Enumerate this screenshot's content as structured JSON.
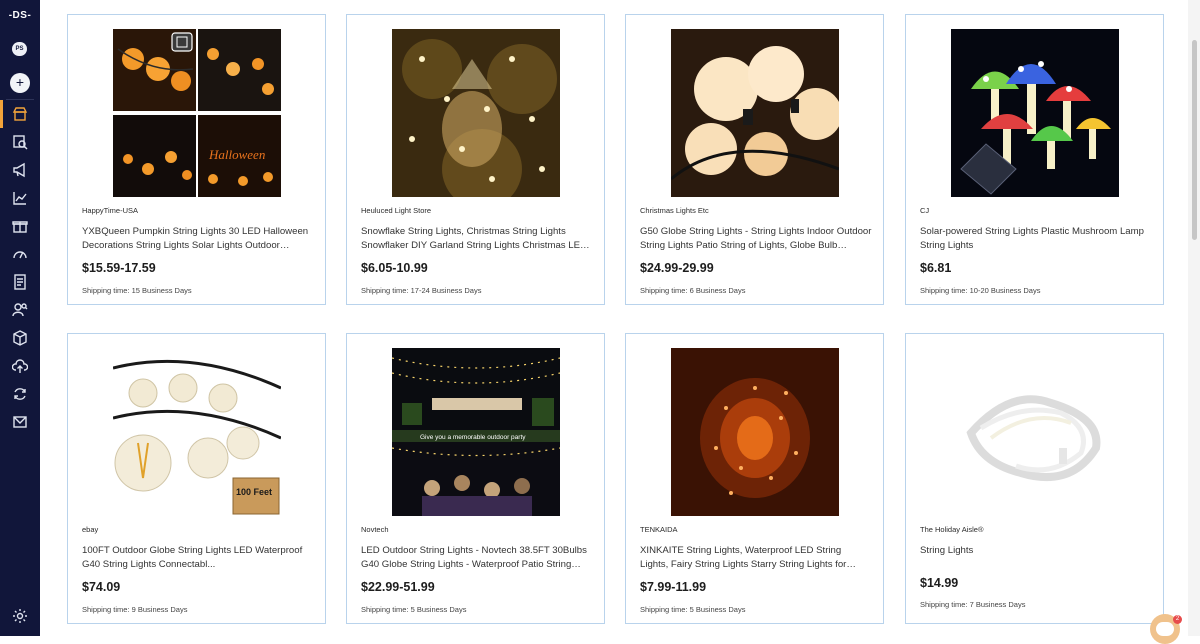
{
  "app": {
    "logo_text": "-DS-",
    "user_badge": "PS",
    "plus_label": "+",
    "chat_count": "2",
    "accent_color": "#f2a33a",
    "sidebar_color": "#11163a",
    "card_border_color": "#b9d3ec"
  },
  "sidebar": {
    "items": [
      {
        "icon": "store-icon",
        "active": true
      },
      {
        "icon": "product-search-icon",
        "active": false
      },
      {
        "icon": "megaphone-icon",
        "active": false
      },
      {
        "icon": "analytics-chart-icon",
        "active": false
      },
      {
        "icon": "gift-icon",
        "active": false
      },
      {
        "icon": "speedometer-icon",
        "active": false
      },
      {
        "icon": "document-list-icon",
        "active": false
      },
      {
        "icon": "user-search-icon",
        "active": false
      },
      {
        "icon": "box-icon",
        "active": false
      },
      {
        "icon": "cloud-upload-icon",
        "active": false
      },
      {
        "icon": "sync-icon",
        "active": false
      },
      {
        "icon": "mail-icon",
        "active": false
      }
    ],
    "settings_icon": "gear-icon"
  },
  "products": [
    {
      "store": "HappyTime-USA",
      "title": "YXBQueen Pumpkin String Lights 30 LED Halloween Decorations String Lights Solar Lights Outdoor Hanging...",
      "price": "$15.59-17.59",
      "shipping": "Shipping time: 15 Business Days",
      "image": "halloween-pumpkin-lights-collage"
    },
    {
      "store": "Heuluced Light Store",
      "title": "Snowflake String Lights, Christmas String Lights Snowflaker DIY Garland String Lights Christmas LED Fai...",
      "price": "$6.05-10.99",
      "shipping": "Shipping time: 17-24 Business Days",
      "image": "snowflake-lights-in-jar"
    },
    {
      "store": "Christmas Lights Etc",
      "title": "G50 Globe String Lights - String Lights Indoor Outdoor String Lights Patio String of Lights, Globe Bulb String...",
      "price": "$24.99-29.99",
      "shipping": "Shipping time: 6 Business Days",
      "image": "globe-bulbs-closeup"
    },
    {
      "store": "CJ",
      "title": "Solar-powered String Lights Plastic Mushroom Lamp String Lights",
      "price": "$6.81",
      "shipping": "Shipping time: 10-20 Business Days",
      "image": "mushroom-solar-lamps"
    },
    {
      "store": "ebay",
      "title": "100FT Outdoor Globe String Lights LED Waterproof G40 String Lights Connectabl...",
      "price": "$74.09",
      "shipping": "Shipping time: 9 Business Days",
      "image": "outdoor-globe-bulbs-with-box",
      "box_text": "100 Feet"
    },
    {
      "store": "Novtech",
      "title": "LED Outdoor String Lights - Novtech 38.5FT 30Bulbs G40 Globe String Lights - Waterproof Patio String Lights...",
      "price": "$22.99-51.99",
      "shipping": "Shipping time: 5 Business Days",
      "image": "outdoor-party-lights",
      "caption": "Give you a memorable outdoor party"
    },
    {
      "store": "TENKAIDA",
      "title": "XINKAITE String Lights, Waterproof LED String Lights, Fairy String Lights Starry String Lights for Indoor&...",
      "price": "$7.99-11.99",
      "shipping": "Shipping time: 5 Business Days",
      "image": "fairy-lights-orange"
    },
    {
      "store": "The Holiday Aisle®",
      "title": "String Lights",
      "price": "$14.99",
      "shipping": "Shipping time: 7 Business Days",
      "image": "white-wire-string-lights"
    }
  ]
}
